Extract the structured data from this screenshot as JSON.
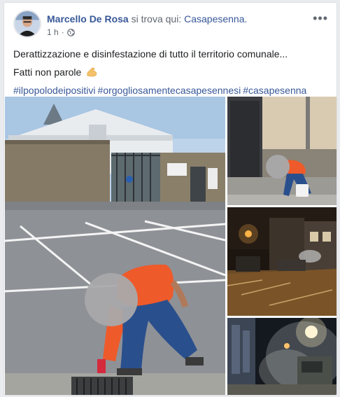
{
  "post": {
    "author": "Marcello De Rosa",
    "verb": " si trova qui: ",
    "place": "Casapesenna.",
    "time": "1 h",
    "separator": "·",
    "text_line1": "Derattizzazione e disinfestazione di tutto il territorio comunale...",
    "text_line2": "Fatti non parole",
    "emoji_icon": "flexed-biceps-icon",
    "hashtags": [
      "#ilpopolodeipositivi",
      "#orgogliosamentecasapesennesi",
      "#casapesenna"
    ],
    "audience_icon": "globe-icon",
    "more_icon": "more-options-icon"
  },
  "colors": {
    "link": "#385898",
    "secondary": "#606770"
  },
  "photos": [
    {
      "name": "photo-main-worker-parking-lot"
    },
    {
      "name": "photo-worker-street-doorway"
    },
    {
      "name": "photo-night-street-spraying"
    },
    {
      "name": "photo-night-fog-truck"
    }
  ]
}
